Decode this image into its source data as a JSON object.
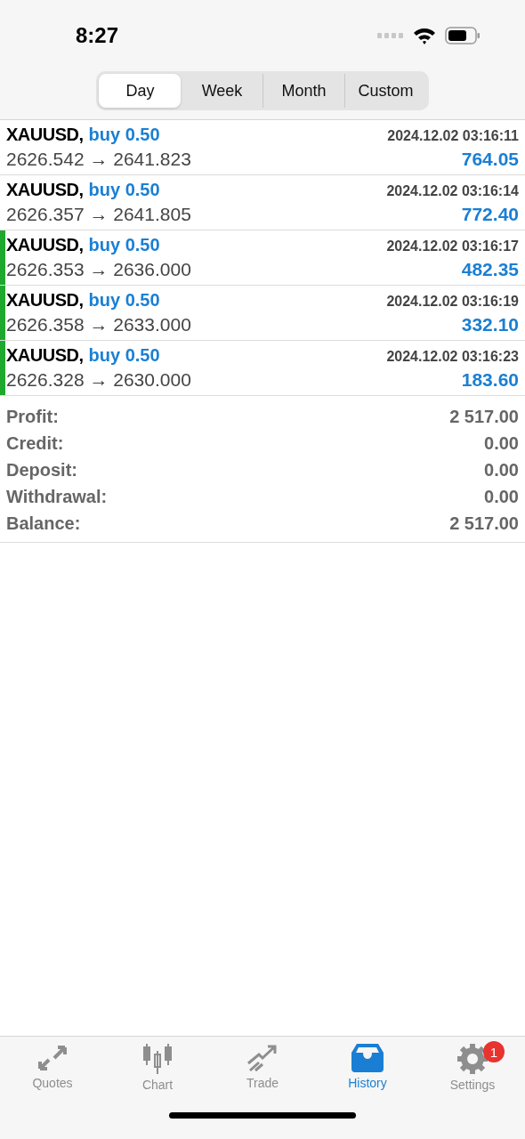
{
  "status_bar": {
    "time": "8:27"
  },
  "tabs": [
    {
      "label": "Day",
      "selected": true
    },
    {
      "label": "Week",
      "selected": false
    },
    {
      "label": "Month",
      "selected": false
    },
    {
      "label": "Custom",
      "selected": false
    }
  ],
  "deals": [
    {
      "symbol": "XAUUSD,",
      "side": "buy 0.50",
      "time": "2024.12.02 03:16:11",
      "prices": "2626.542 → 2641.823",
      "profit": "764.05",
      "highlighted": false
    },
    {
      "symbol": "XAUUSD,",
      "side": "buy 0.50",
      "time": "2024.12.02 03:16:14",
      "prices": "2626.357 → 2641.805",
      "profit": "772.40",
      "highlighted": false
    },
    {
      "symbol": "XAUUSD,",
      "side": "buy 0.50",
      "time": "2024.12.02 03:16:17",
      "prices": "2626.353 → 2636.000",
      "profit": "482.35",
      "highlighted": true
    },
    {
      "symbol": "XAUUSD,",
      "side": "buy 0.50",
      "time": "2024.12.02 03:16:19",
      "prices": "2626.358 → 2633.000",
      "profit": "332.10",
      "highlighted": true
    },
    {
      "symbol": "XAUUSD,",
      "side": "buy 0.50",
      "time": "2024.12.02 03:16:23",
      "prices": "2626.328 → 2630.000",
      "profit": "183.60",
      "highlighted": true
    }
  ],
  "summary": [
    {
      "label": "Profit:",
      "value": "2 517.00"
    },
    {
      "label": "Credit:",
      "value": "0.00"
    },
    {
      "label": "Deposit:",
      "value": "0.00"
    },
    {
      "label": "Withdrawal:",
      "value": "0.00"
    },
    {
      "label": "Balance:",
      "value": "2 517.00"
    }
  ],
  "tab_bar": [
    {
      "kind": "quotes",
      "label": "Quotes",
      "selected": false
    },
    {
      "kind": "chart",
      "label": "Chart",
      "selected": false
    },
    {
      "kind": "trade",
      "label": "Trade",
      "selected": false
    },
    {
      "kind": "history",
      "label": "History",
      "selected": true
    },
    {
      "kind": "settings",
      "label": "Settings",
      "selected": false,
      "badge": "1"
    }
  ]
}
